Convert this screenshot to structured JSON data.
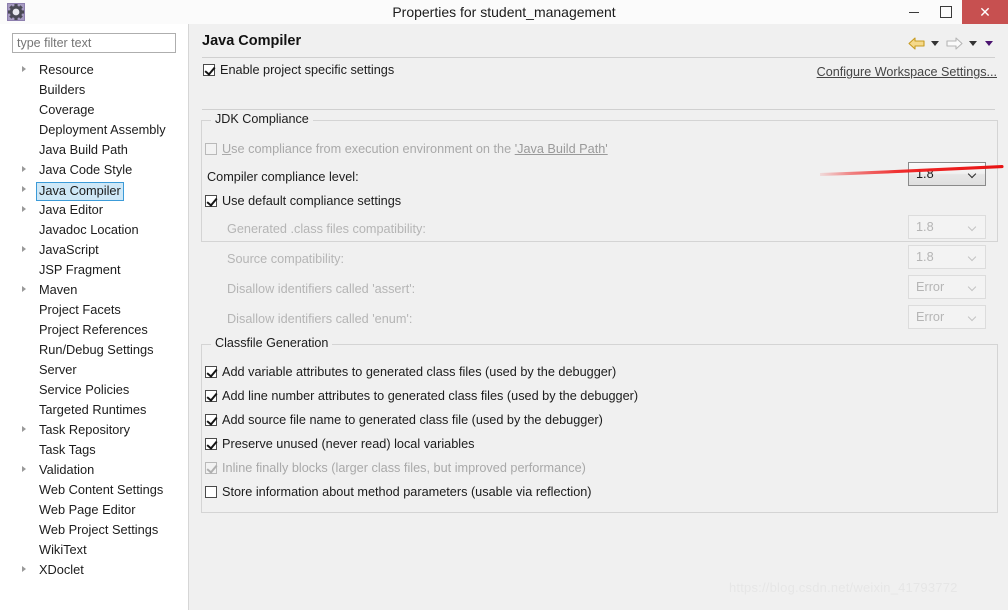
{
  "window": {
    "title": "Properties for student_management",
    "icon": "properties-gear-icon",
    "minimize_label": "",
    "maximize_label": "",
    "close_label": "✕"
  },
  "sidebar": {
    "filter": {
      "value": "",
      "placeholder": "type filter text"
    },
    "items": [
      {
        "label": "Resource",
        "expandable": true
      },
      {
        "label": "Builders",
        "expandable": false
      },
      {
        "label": "Coverage",
        "expandable": false
      },
      {
        "label": "Deployment Assembly",
        "expandable": false
      },
      {
        "label": "Java Build Path",
        "expandable": false
      },
      {
        "label": "Java Code Style",
        "expandable": true
      },
      {
        "label": "Java Compiler",
        "expandable": true,
        "selected": true
      },
      {
        "label": "Java Editor",
        "expandable": true
      },
      {
        "label": "Javadoc Location",
        "expandable": false
      },
      {
        "label": "JavaScript",
        "expandable": true
      },
      {
        "label": "JSP Fragment",
        "expandable": false
      },
      {
        "label": "Maven",
        "expandable": true
      },
      {
        "label": "Project Facets",
        "expandable": false
      },
      {
        "label": "Project References",
        "expandable": false
      },
      {
        "label": "Run/Debug Settings",
        "expandable": false
      },
      {
        "label": "Server",
        "expandable": false
      },
      {
        "label": "Service Policies",
        "expandable": false
      },
      {
        "label": "Targeted Runtimes",
        "expandable": false
      },
      {
        "label": "Task Repository",
        "expandable": true
      },
      {
        "label": "Task Tags",
        "expandable": false
      },
      {
        "label": "Validation",
        "expandable": true
      },
      {
        "label": "Web Content Settings",
        "expandable": false
      },
      {
        "label": "Web Page Editor",
        "expandable": false
      },
      {
        "label": "Web Project Settings",
        "expandable": false
      },
      {
        "label": "WikiText",
        "expandable": false
      },
      {
        "label": "XDoclet",
        "expandable": true
      }
    ]
  },
  "main": {
    "title": "Java Compiler",
    "toolbar": {
      "back_icon": "arrow-back-icon",
      "back_menu_icon": "chevron-down-icon",
      "forward_icon": "arrow-forward-icon",
      "forward_menu_icon": "chevron-down-icon",
      "view_menu_icon": "chevron-down-icon"
    },
    "enable_project_specific": {
      "label": "Enable project specific settings",
      "checked": true
    },
    "configure_workspace_link": "Configure Workspace Settings...",
    "jdk_compliance": {
      "title": "JDK Compliance",
      "use_execution_env": {
        "label_pre": "",
        "mnemonic": "U",
        "label_mid": "se compliance from execution environment on the ",
        "link": "'Java Build Path'",
        "checked": false,
        "disabled": true
      },
      "compiler_compliance_level": {
        "label": "Compiler compliance level:",
        "value": "1.8",
        "disabled": false
      },
      "use_default_compliance": {
        "label": "Use default compliance settings",
        "checked": true,
        "disabled": false
      },
      "generated_class_compatibility": {
        "label": "Generated .class files compatibility:",
        "value": "1.8",
        "disabled": true
      },
      "source_compatibility": {
        "label": "Source compatibility:",
        "value": "1.8",
        "disabled": true
      },
      "disallow_assert": {
        "label": "Disallow identifiers called 'assert':",
        "value": "Error",
        "disabled": true
      },
      "disallow_enum": {
        "label": "Disallow identifiers called 'enum':",
        "value": "Error",
        "disabled": true
      }
    },
    "classfile_generation": {
      "title": "Classfile Generation",
      "options": [
        {
          "label": "Add variable attributes to generated class files (used by the debugger)",
          "checked": true,
          "disabled": false
        },
        {
          "label": "Add line number attributes to generated class files (used by the debugger)",
          "checked": true,
          "disabled": false
        },
        {
          "label": "Add source file name to generated class file (used by the debugger)",
          "checked": true,
          "disabled": false
        },
        {
          "label": "Preserve unused (never read) local variables",
          "checked": true,
          "disabled": false
        },
        {
          "label": "Inline finally blocks (larger class files, but improved performance)",
          "checked": true,
          "disabled": true
        },
        {
          "label": "Store information about method parameters (usable via reflection)",
          "checked": false,
          "disabled": false
        }
      ]
    }
  },
  "annotation": {
    "type": "hand-drawn-underline",
    "color": "#ee2222"
  },
  "watermark": {
    "text": "https://blog.csdn.net/weixin_41793772"
  },
  "colors": {
    "selection_fill": "#cfe8f7",
    "selection_border": "#3c9bd8",
    "close_button": "#c75050",
    "annotation_red": "#ee2222",
    "panel_bg": "#f0f0f0",
    "tree_bg": "#ffffff"
  }
}
